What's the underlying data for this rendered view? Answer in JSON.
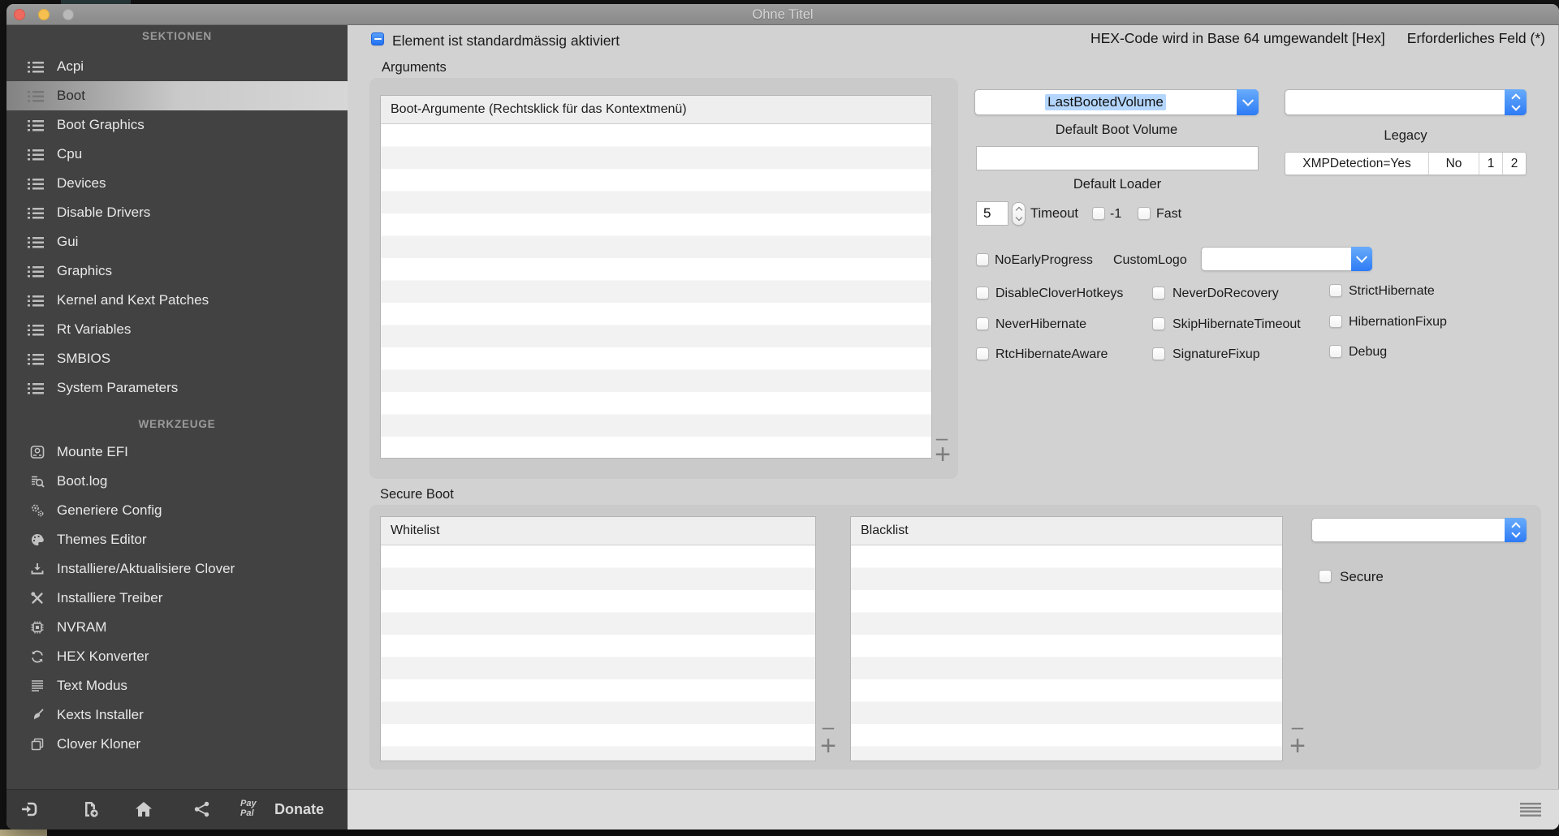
{
  "window": {
    "title": "Ohne Titel"
  },
  "notes": {
    "hex": "HEX-Code wird in Base 64 umgewandelt [Hex]",
    "required": "Erforderliches Feld (*)"
  },
  "header": {
    "default_enabled": "Element ist standardmässig aktiviert"
  },
  "sidebar": {
    "sections_title": "SEKTIONEN",
    "sections": [
      {
        "label": "Acpi"
      },
      {
        "label": "Boot"
      },
      {
        "label": "Boot Graphics"
      },
      {
        "label": "Cpu"
      },
      {
        "label": "Devices"
      },
      {
        "label": "Disable Drivers"
      },
      {
        "label": "Gui"
      },
      {
        "label": "Graphics"
      },
      {
        "label": "Kernel and Kext Patches"
      },
      {
        "label": "Rt Variables"
      },
      {
        "label": "SMBIOS"
      },
      {
        "label": "System Parameters"
      }
    ],
    "tools_title": "WERKZEUGE",
    "tools": [
      {
        "label": "Mounte EFI",
        "icon": "drive-icon"
      },
      {
        "label": "Boot.log",
        "icon": "log-search-icon"
      },
      {
        "label": "Generiere Config",
        "icon": "gears-icon"
      },
      {
        "label": "Themes Editor",
        "icon": "palette-icon"
      },
      {
        "label": "Installiere/Aktualisiere Clover",
        "icon": "download-icon"
      },
      {
        "label": "Installiere Treiber",
        "icon": "tools-icon"
      },
      {
        "label": "NVRAM",
        "icon": "chip-icon"
      },
      {
        "label": "HEX Konverter",
        "icon": "refresh-icon"
      },
      {
        "label": "Text Modus",
        "icon": "text-lines-icon"
      },
      {
        "label": "Kexts Installer",
        "icon": "brush-icon"
      },
      {
        "label": "Clover Kloner",
        "icon": "copy-icon"
      }
    ],
    "footer": {
      "paypal_line1": "Pay",
      "paypal_line2": "Pal",
      "donate": "Donate"
    }
  },
  "arguments": {
    "title": "Arguments",
    "table_header": "Boot-Argumente (Rechtsklick für das Kontextmenü)",
    "add": "+",
    "remove": "–"
  },
  "boot": {
    "default_boot_volume": {
      "value": "LastBootedVolume",
      "label": "Default Boot Volume"
    },
    "legacy": {
      "label": "Legacy",
      "value": ""
    },
    "default_loader": {
      "label": "Default Loader",
      "value": ""
    },
    "xmp_segments": [
      "XMPDetection=Yes",
      "No",
      "1",
      "2"
    ],
    "timeout": {
      "value": "5",
      "label": "Timeout"
    },
    "neg1_label": "-1",
    "fast_label": "Fast",
    "no_early_progress": "NoEarlyProgress",
    "custom_logo_label": "CustomLogo",
    "custom_logo_value": "",
    "grid": [
      [
        "DisableCloverHotkeys",
        "NeverDoRecovery",
        "StrictHibernate"
      ],
      [
        "NeverHibernate",
        "SkipHibernateTimeout",
        "HibernationFixup"
      ],
      [
        "RtcHibernateAware",
        "SignatureFixup",
        "Debug"
      ]
    ]
  },
  "secure": {
    "title": "Secure Boot",
    "whitelist": "Whitelist",
    "blacklist": "Blacklist",
    "secure_label": "Secure",
    "add": "+",
    "remove": "–"
  },
  "colors": {
    "accent_blue": "#2d7bf5",
    "selection": "#b4d6fc",
    "sidebar": "#424242",
    "main_bg": "#d2d2d2"
  }
}
